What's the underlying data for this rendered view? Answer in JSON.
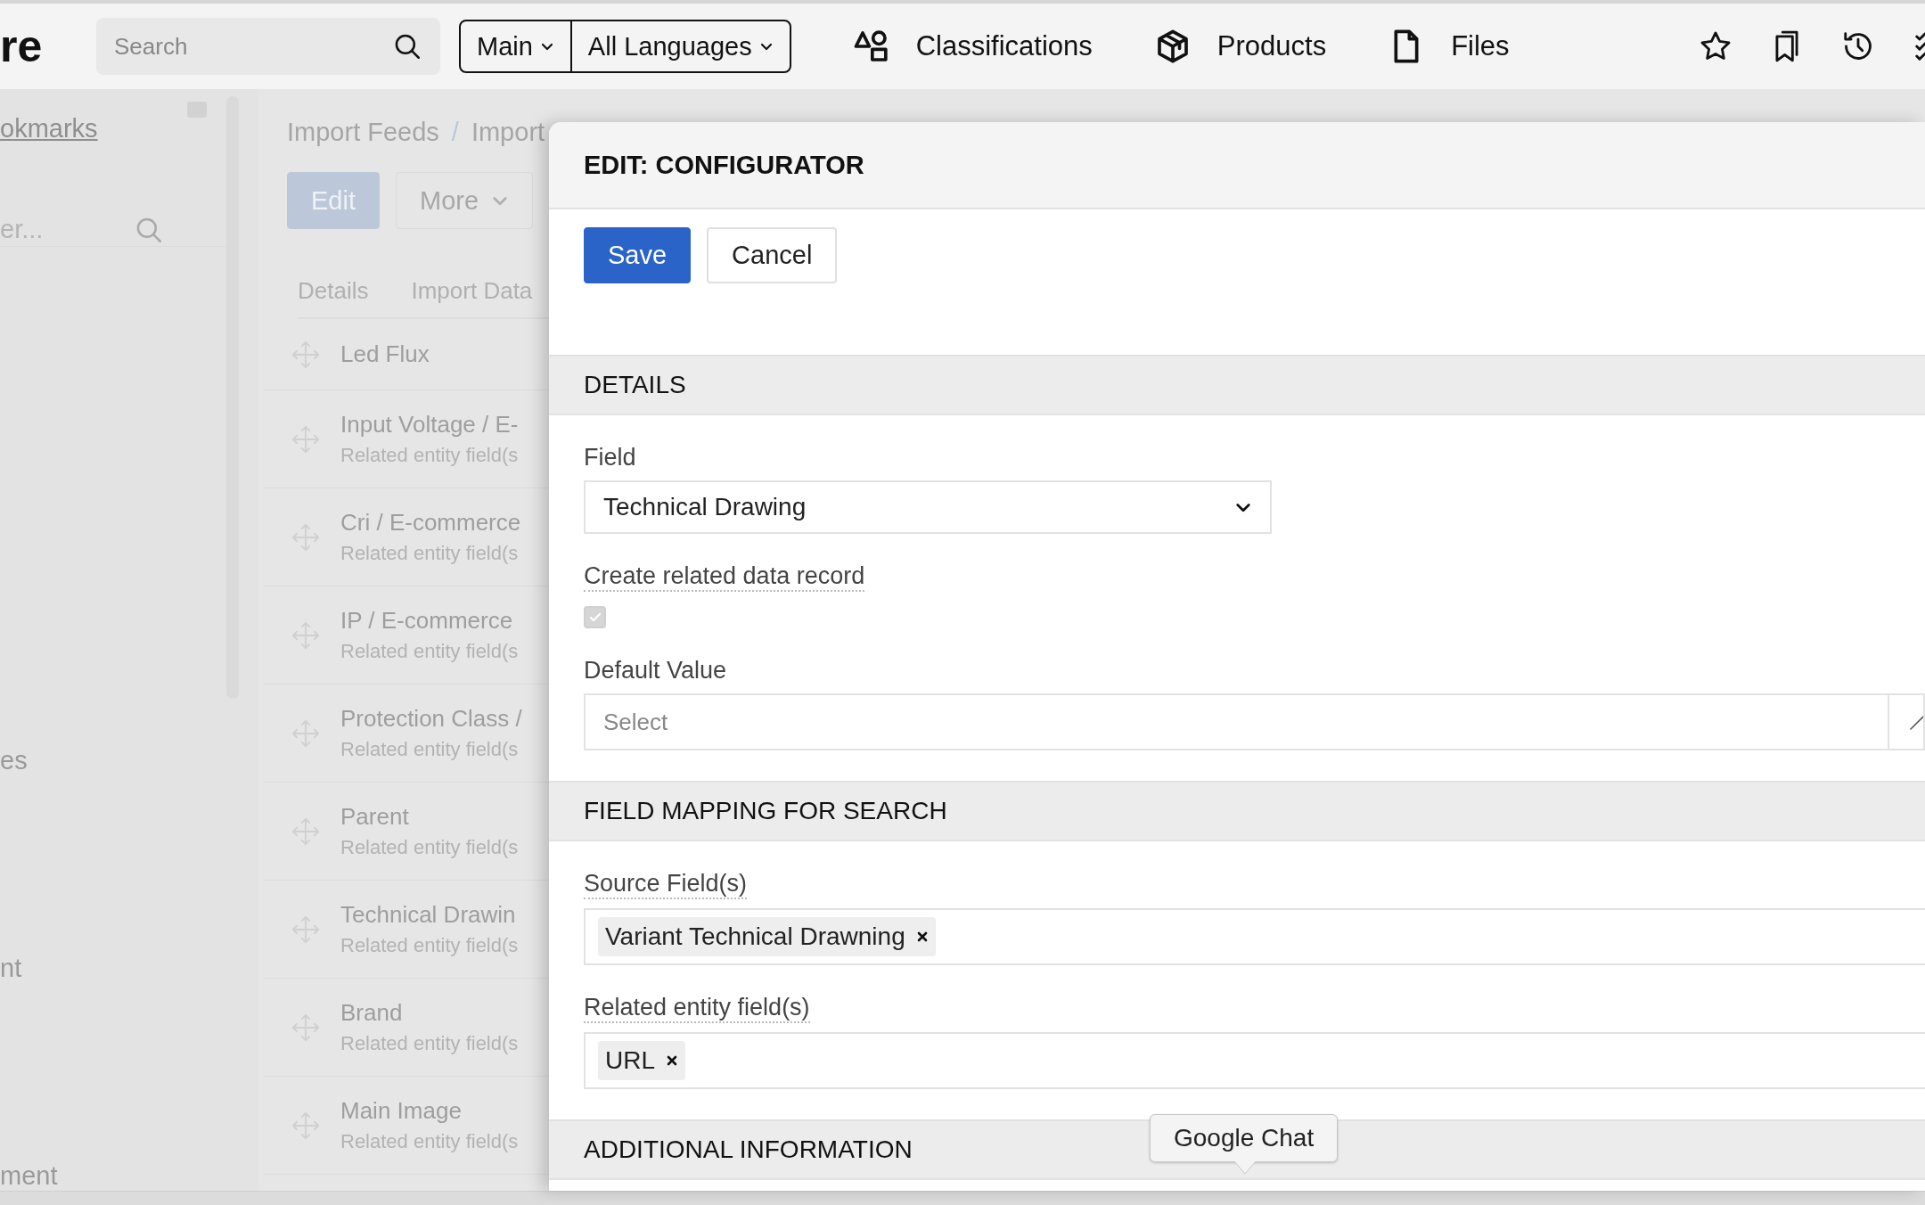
{
  "topbar": {
    "logo": "re",
    "search": {
      "placeholder": "Search"
    },
    "scope": [
      {
        "label": "Main"
      },
      {
        "label": "All Languages"
      }
    ],
    "nav": [
      {
        "kind": "classifications",
        "label": "Classifications"
      },
      {
        "kind": "products",
        "label": "Products"
      },
      {
        "kind": "files",
        "label": "Files"
      }
    ],
    "actions": [
      {
        "kind": "star"
      },
      {
        "kind": "bookmark"
      },
      {
        "kind": "history"
      },
      {
        "kind": "checklist"
      }
    ]
  },
  "sidebar": {
    "link": "okmarks",
    "filter": {
      "placeholder": "er..."
    },
    "items": [
      "es",
      "nt",
      "ment"
    ]
  },
  "page": {
    "breadcrumb": [
      "Import Feeds",
      "Import"
    ],
    "breadcrumb_separator": "/",
    "buttons": [
      {
        "kind": "primary",
        "label": "Edit"
      },
      {
        "kind": "dropdown",
        "label": "More"
      }
    ],
    "tabs": [
      {
        "label": "Details",
        "selected": false
      },
      {
        "label": "Import Data",
        "selected": false
      }
    ],
    "rows": [
      {
        "title": "Led Flux"
      },
      {
        "title": "Input Voltage / E-",
        "subtitle": "Related entity field(s"
      },
      {
        "title": "Cri / E-commerce",
        "subtitle": "Related entity field(s"
      },
      {
        "title": "IP / E-commerce",
        "subtitle": "Related entity field(s"
      },
      {
        "title": "Protection Class /",
        "subtitle": "Related entity field(s"
      },
      {
        "title": "Parent",
        "subtitle": "Related entity field(s"
      },
      {
        "title": "Technical Drawin",
        "subtitle": "Related entity field(s"
      },
      {
        "title": "Brand",
        "subtitle": "Related entity field(s"
      },
      {
        "title": "Main Image",
        "subtitle": "Related entity field(s"
      }
    ]
  },
  "modal": {
    "title": "EDIT: CONFIGURATOR",
    "buttons": [
      {
        "kind": "primary",
        "label": "Save"
      },
      {
        "kind": "secondary",
        "label": "Cancel"
      }
    ],
    "sections": [
      {
        "title": "DETAILS",
        "fields": [
          {
            "kind": "select",
            "label": "Field",
            "value": "Technical Drawing"
          },
          {
            "kind": "checkbox",
            "label": "Create related data record",
            "checked": true,
            "disabled": true
          },
          {
            "kind": "lookup",
            "label": "Default Value",
            "placeholder": "Select"
          }
        ]
      },
      {
        "title": "FIELD MAPPING FOR SEARCH",
        "fields": [
          {
            "kind": "tags",
            "label": "Source Field(s)",
            "tags": [
              "Variant Technical Drawning"
            ]
          },
          {
            "kind": "tags",
            "label": "Related entity field(s)",
            "tags": [
              "URL"
            ]
          }
        ]
      },
      {
        "title": "ADDITIONAL INFORMATION"
      }
    ]
  },
  "tooltip": {
    "text": "Google Chat"
  }
}
